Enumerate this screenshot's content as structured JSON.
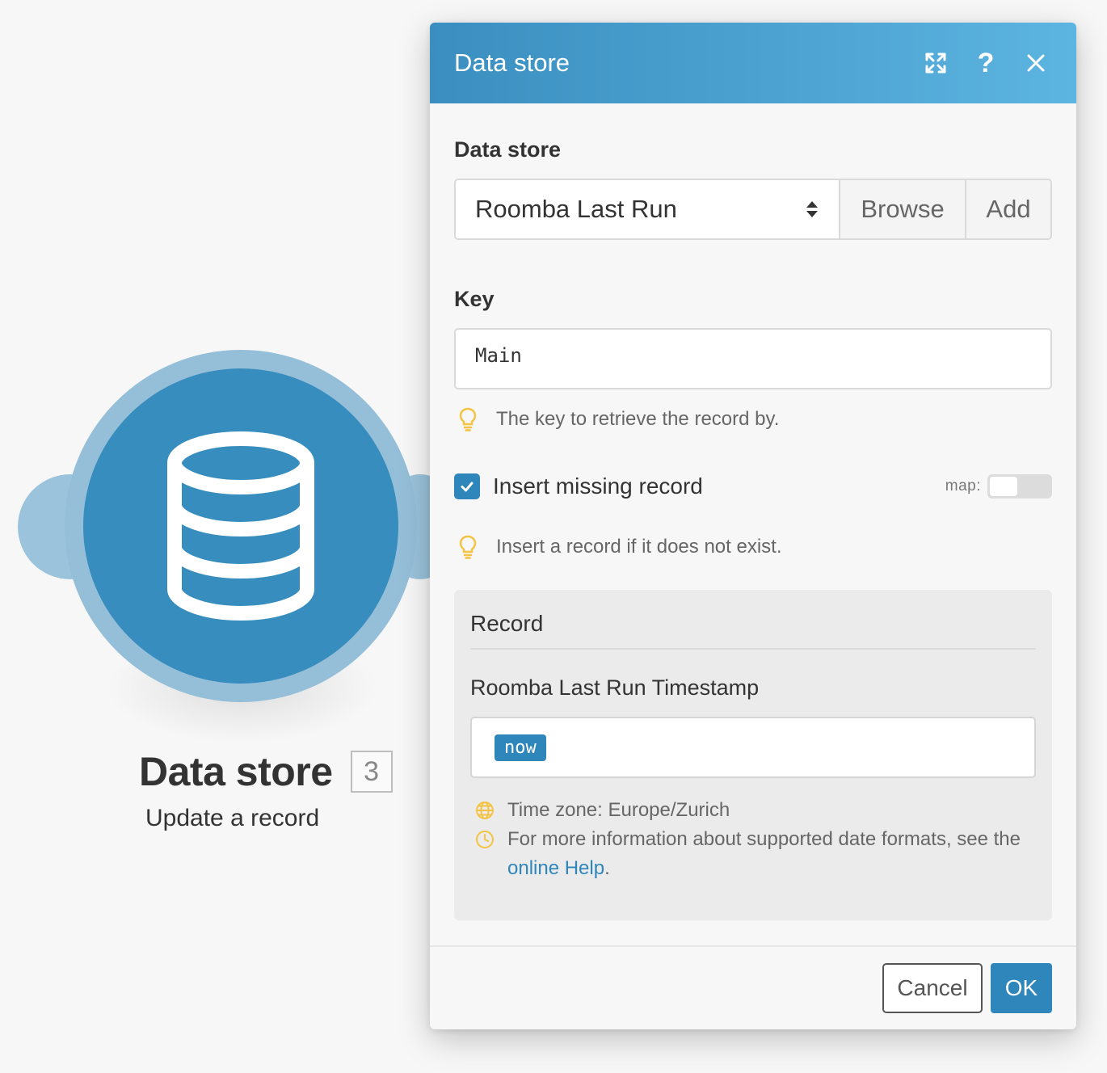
{
  "node": {
    "title": "Data store",
    "badge": "3",
    "subtitle": "Update a record",
    "icon": "database-icon"
  },
  "dialog": {
    "title": "Data store",
    "header_icons": [
      "expand-icon",
      "help-icon",
      "close-icon"
    ],
    "help_glyph": "?",
    "data_store": {
      "label": "Data store",
      "selected": "Roomba Last Run",
      "browse_label": "Browse",
      "add_label": "Add"
    },
    "key": {
      "label": "Key",
      "value": "Main",
      "hint": "The key to retrieve the record by."
    },
    "insert_missing": {
      "label": "Insert missing record",
      "checked": true,
      "map_label": "map:",
      "hint": "Insert a record if it does not exist."
    },
    "record": {
      "title": "Record",
      "field_label": "Roomba Last Run Timestamp",
      "field_value_pill": "now",
      "timezone_text": "Time zone: Europe/Zurich",
      "info_text_before": "For more information about supported date formats, see the ",
      "info_link": "online Help",
      "info_text_after": "."
    },
    "footer": {
      "cancel_label": "Cancel",
      "ok_label": "OK"
    }
  },
  "colors": {
    "accent": "#2f86bb",
    "header_start": "#3a8fc0",
    "header_end": "#5cb4e0",
    "hint_icon": "#f5c343"
  }
}
